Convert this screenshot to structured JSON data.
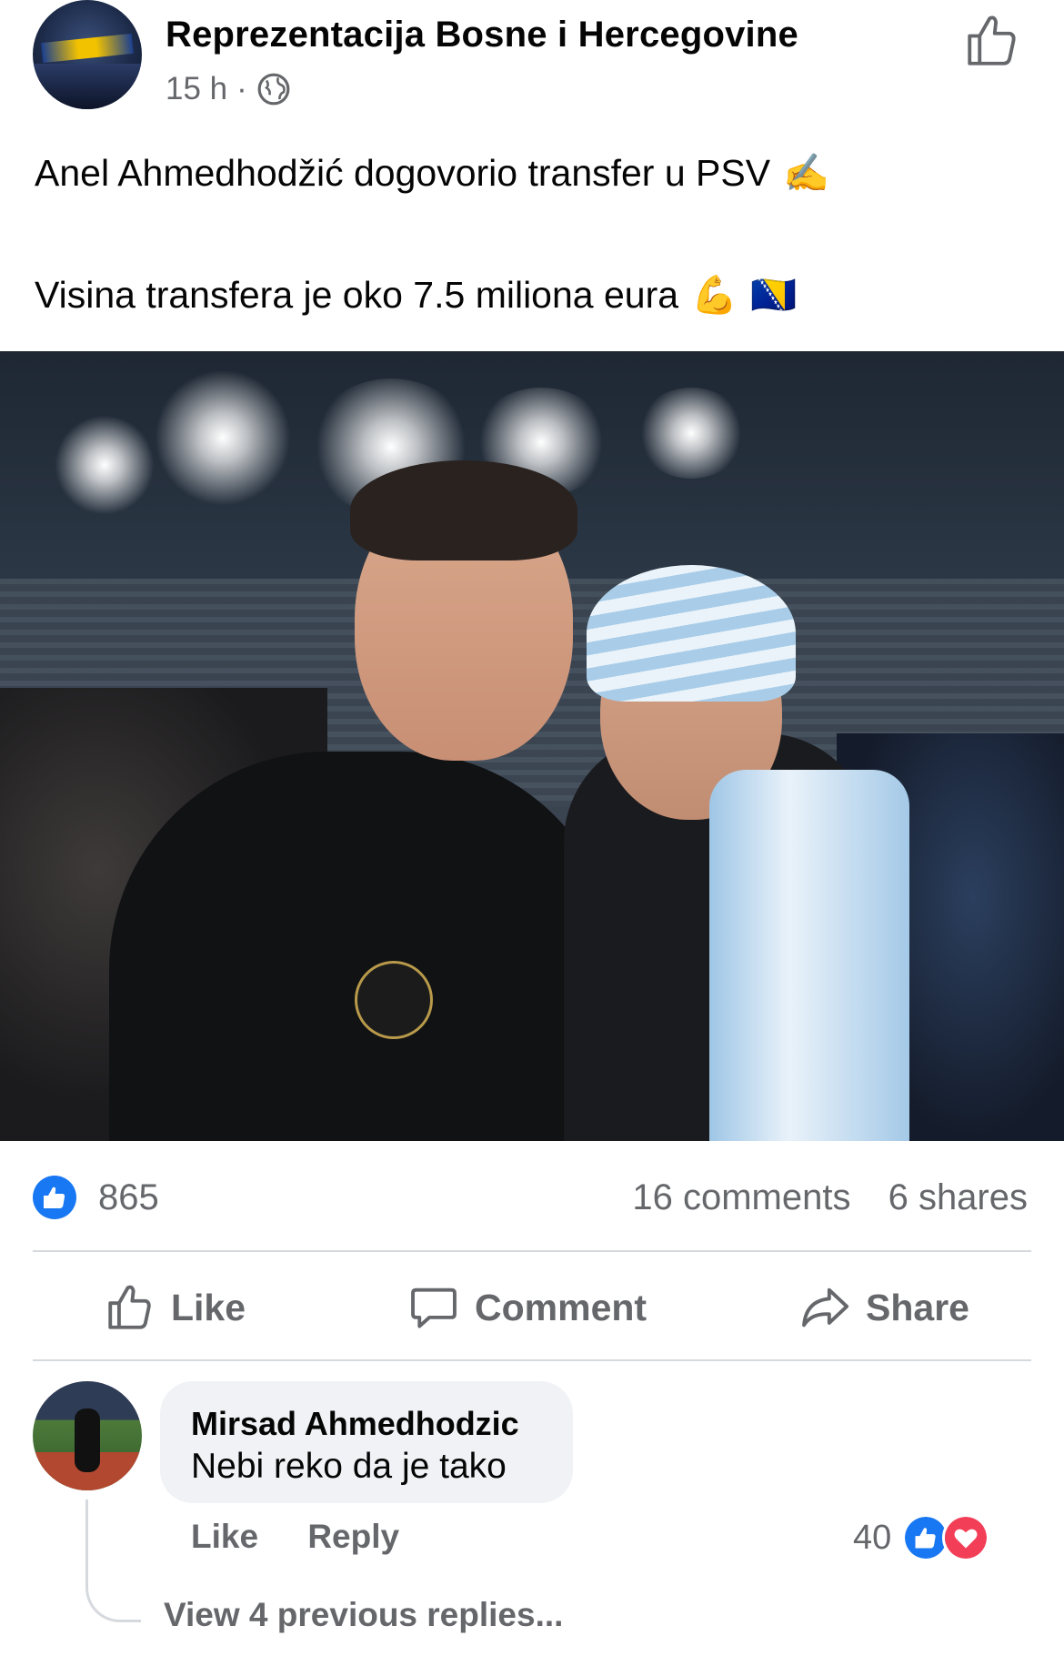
{
  "post": {
    "page_name": "Reprezentacija Bosne i Hercegovine",
    "time": "15 h",
    "separator": "·",
    "privacy_icon": "globe-icon",
    "header_action_icon": "thumbs-up-outline-icon",
    "text_line1": "Anel Ahmedhodžić dogovorio transfer u PSV",
    "text_line1_emoji": "✍️",
    "text_line2": "Visina transfera je oko 7.5 miliona eura",
    "text_line2_emoji": "💪",
    "text_line2_flag": "🇧🇦"
  },
  "stats": {
    "reaction_count": "865",
    "comments": "16 comments",
    "shares": "6 shares"
  },
  "actions": {
    "like": "Like",
    "comment": "Comment",
    "share": "Share"
  },
  "comment": {
    "author": "Mirsad Ahmedhodzic",
    "text": "Nebi reko da je tako",
    "like_label": "Like",
    "reply_label": "Reply",
    "reaction_count": "40",
    "view_replies": "View 4 previous replies..."
  },
  "colors": {
    "accent_blue": "#1877f2",
    "love_red": "#f33e58",
    "secondary_text": "#65676b",
    "bubble_bg": "#f0f2f5"
  }
}
